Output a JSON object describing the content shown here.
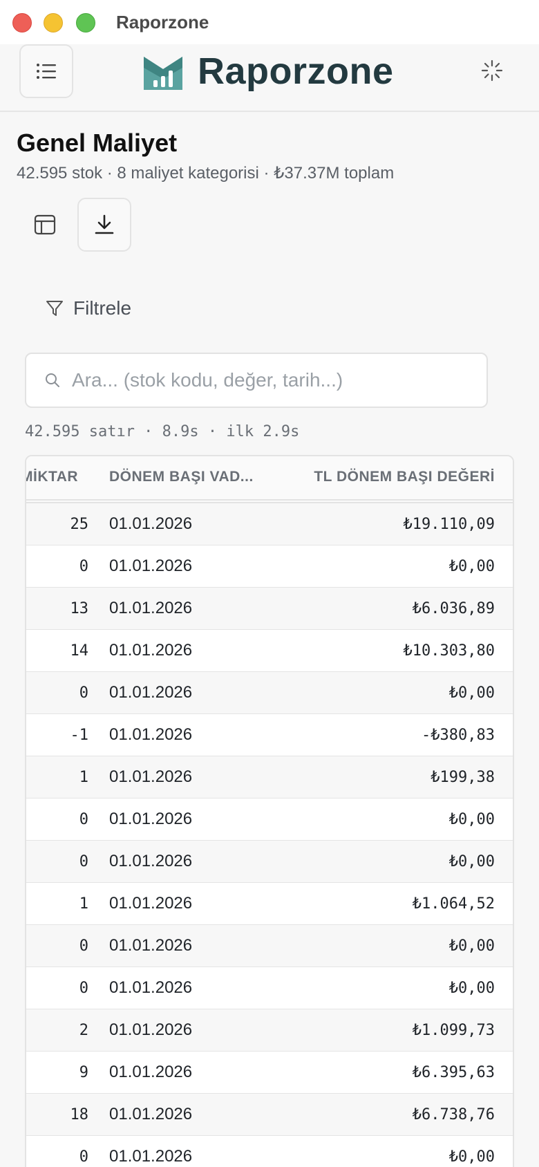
{
  "window": {
    "title": "Raporzone"
  },
  "header": {
    "brand": "Raporzone"
  },
  "page": {
    "title": "Genel Maliyet",
    "subtitle": "42.595 stok · 8 maliyet kategorisi · ₺37.37M toplam"
  },
  "filter": {
    "label": "Filtrele"
  },
  "search": {
    "placeholder": "Ara... (stok kodu, değer, tarih...)",
    "value": ""
  },
  "stats": "42.595 satır · 8.9s · ilk 2.9s",
  "table": {
    "columns": [
      "MİKTAR",
      "DÖNEM BAŞI VAD...",
      "TL DÖNEM BAŞI DEĞERİ"
    ],
    "rows": [
      [
        "25",
        "01.01.2026",
        "₺19.110,09"
      ],
      [
        "0",
        "01.01.2026",
        "₺0,00"
      ],
      [
        "13",
        "01.01.2026",
        "₺6.036,89"
      ],
      [
        "14",
        "01.01.2026",
        "₺10.303,80"
      ],
      [
        "0",
        "01.01.2026",
        "₺0,00"
      ],
      [
        "-1",
        "01.01.2026",
        "-₺380,83"
      ],
      [
        "1",
        "01.01.2026",
        "₺199,38"
      ],
      [
        "0",
        "01.01.2026",
        "₺0,00"
      ],
      [
        "0",
        "01.01.2026",
        "₺0,00"
      ],
      [
        "1",
        "01.01.2026",
        "₺1.064,52"
      ],
      [
        "0",
        "01.01.2026",
        "₺0,00"
      ],
      [
        "0",
        "01.01.2026",
        "₺0,00"
      ],
      [
        "2",
        "01.01.2026",
        "₺1.099,73"
      ],
      [
        "9",
        "01.01.2026",
        "₺6.395,63"
      ],
      [
        "18",
        "01.01.2026",
        "₺6.738,76"
      ],
      [
        "0",
        "01.01.2026",
        "₺0,00"
      ]
    ]
  },
  "icons": {
    "menu": "menu-icon",
    "logo": "bar-chart-logo-icon",
    "loading": "spinner-icon",
    "table_view": "table-icon",
    "download": "download-icon",
    "filter": "filter-icon",
    "search": "search-icon"
  },
  "colors": {
    "brand": "#233a40",
    "logo_accent": "#5aa3a0"
  }
}
